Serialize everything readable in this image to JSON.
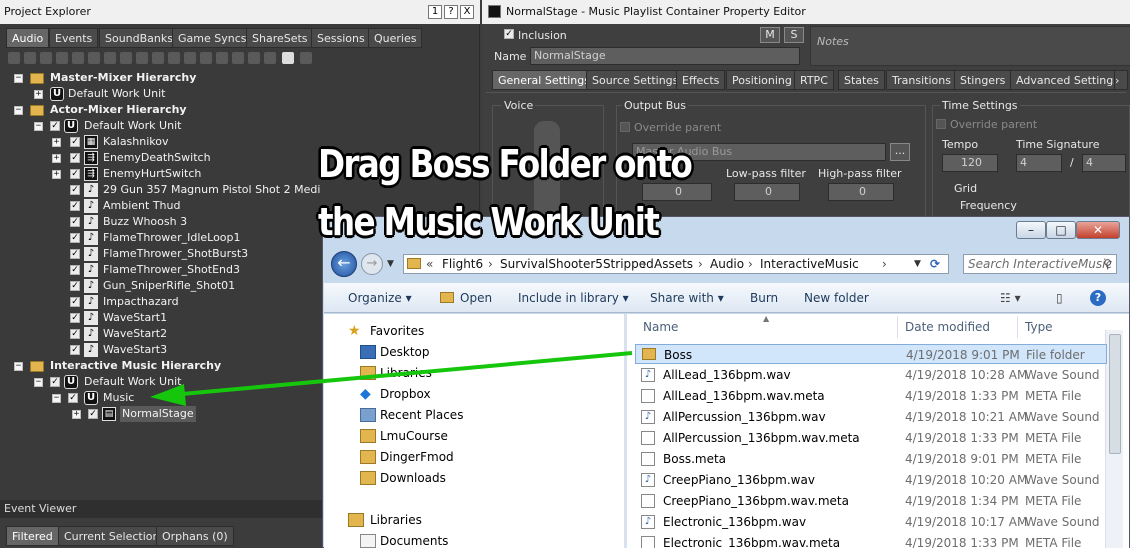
{
  "project_explorer": {
    "title": "Project Explorer",
    "title_buttons": [
      "1",
      "?",
      "X"
    ],
    "tabs": [
      "Audio",
      "Events",
      "SoundBanks",
      "Game Syncs",
      "ShareSets",
      "Sessions",
      "Queries"
    ],
    "active_tab": "Audio",
    "tree": [
      {
        "label": "Master-Mixer Hierarchy",
        "type": "hierarchy"
      },
      {
        "label": "Default Work Unit",
        "type": "workunit"
      },
      {
        "label": "Actor-Mixer Hierarchy",
        "type": "hierarchy"
      },
      {
        "label": "Default Work Unit",
        "type": "workunit"
      },
      {
        "label": "Kalashnikov",
        "type": "container"
      },
      {
        "label": "EnemyDeathSwitch",
        "type": "switch"
      },
      {
        "label": "EnemyHurtSwitch",
        "type": "switch"
      },
      {
        "label": "29 Gun 357 Magnum Pistol Shot 2 Medi",
        "type": "sound"
      },
      {
        "label": "Ambient Thud",
        "type": "sound"
      },
      {
        "label": "Buzz Whoosh 3",
        "type": "sound"
      },
      {
        "label": "FlameThrower_IdleLoop1",
        "type": "sound"
      },
      {
        "label": "FlameThrower_ShotBurst3",
        "type": "sound"
      },
      {
        "label": "FlameThrower_ShotEnd3",
        "type": "sound"
      },
      {
        "label": "Gun_SniperRifle_Shot01",
        "type": "sound"
      },
      {
        "label": "Impacthazard",
        "type": "sound"
      },
      {
        "label": "WaveStart1",
        "type": "sound"
      },
      {
        "label": "WaveStart2",
        "type": "sound"
      },
      {
        "label": "WaveStart3",
        "type": "sound"
      },
      {
        "label": "Interactive Music Hierarchy",
        "type": "hierarchy"
      },
      {
        "label": "Default Work Unit",
        "type": "workunit"
      },
      {
        "label": "Music",
        "type": "workunit"
      },
      {
        "label": "NormalStage",
        "type": "playlist"
      }
    ]
  },
  "event_viewer": {
    "title": "Event Viewer",
    "tabs": [
      "Filtered",
      "Current Selection",
      "Orphans (0)"
    ],
    "active_tab": "Filtered"
  },
  "property_editor": {
    "title": "NormalStage - Music Playlist Container Property Editor",
    "inclusion_label": "Inclusion",
    "m_button": "M",
    "s_button": "S",
    "notes_placeholder": "Notes",
    "name_label": "Name",
    "name_value": "NormalStage",
    "tabs": [
      "General Settings",
      "Source Settings",
      "Effects",
      "Positioning",
      "RTPC",
      "States",
      "Transitions",
      "Stingers",
      "Advanced Settings"
    ],
    "active_tab": "General Settings",
    "voice_label": "Voice",
    "output_bus_label": "Output Bus",
    "override_parent": "Override parent",
    "bus_value": "Master Audio Bus",
    "more_button": "...",
    "lowpass_label": "Low-pass filter",
    "lowpass_value": "0",
    "highpass_label": "High-pass filter",
    "highpass_value": "0",
    "volume_value": "0",
    "time_settings_label": "Time Settings",
    "time_override_parent": "Override parent",
    "tempo_label": "Tempo",
    "tempo_value": "120",
    "time_signature_label": "Time Signature",
    "time_sig_num": "4",
    "time_sig_sep": "/",
    "time_sig_den": "4",
    "grid_label": "Grid",
    "frequency_label": "Frequency"
  },
  "overlay": {
    "line1": "Drag Boss Folder onto",
    "line2": "the Music Work Unit",
    "arrow_color": "#16c60c"
  },
  "explorer_window": {
    "address_segments": [
      "Flight6",
      "SurvivalShooter5Stripped",
      "Assets",
      "Audio",
      "InteractiveMusic"
    ],
    "search_placeholder": "Search InteractiveMusic",
    "commands": [
      "Organize",
      "Open",
      "Include in library",
      "Share with",
      "Burn",
      "New folder"
    ],
    "nav": {
      "favorites_header": "Favorites",
      "favorites": [
        "Desktop",
        "Libraries",
        "Dropbox",
        "Recent Places",
        "LmuCourse",
        "DingerFmod",
        "Downloads"
      ],
      "libraries_header": "Libraries",
      "libraries": [
        "Documents"
      ]
    },
    "columns": [
      "Name",
      "Date modified",
      "Type"
    ],
    "files": [
      {
        "name": "Boss",
        "date": "4/19/2018 9:01 PM",
        "type": "File folder",
        "icon": "folder-icon"
      },
      {
        "name": "AllLead_136bpm.wav",
        "date": "4/19/2018 10:28 AM",
        "type": "Wave Sound",
        "icon": "wave-file-icon"
      },
      {
        "name": "AllLead_136bpm.wav.meta",
        "date": "4/19/2018 1:33 PM",
        "type": "META File",
        "icon": "file-icon"
      },
      {
        "name": "AllPercussion_136bpm.wav",
        "date": "4/19/2018 10:21 AM",
        "type": "Wave Sound",
        "icon": "wave-file-icon"
      },
      {
        "name": "AllPercussion_136bpm.wav.meta",
        "date": "4/19/2018 1:33 PM",
        "type": "META File",
        "icon": "file-icon"
      },
      {
        "name": "Boss.meta",
        "date": "4/19/2018 9:01 PM",
        "type": "META File",
        "icon": "file-icon"
      },
      {
        "name": "CreepPiano_136bpm.wav",
        "date": "4/19/2018 10:20 AM",
        "type": "Wave Sound",
        "icon": "wave-file-icon"
      },
      {
        "name": "CreepPiano_136bpm.wav.meta",
        "date": "4/19/2018 1:34 PM",
        "type": "META File",
        "icon": "file-icon"
      },
      {
        "name": "Electronic_136bpm.wav",
        "date": "4/19/2018 10:17 AM",
        "type": "Wave Sound",
        "icon": "wave-file-icon"
      },
      {
        "name": "Electronic_136bpm.wav.meta",
        "date": "4/19/2018 1:33 PM",
        "type": "META File",
        "icon": "file-icon"
      }
    ]
  }
}
